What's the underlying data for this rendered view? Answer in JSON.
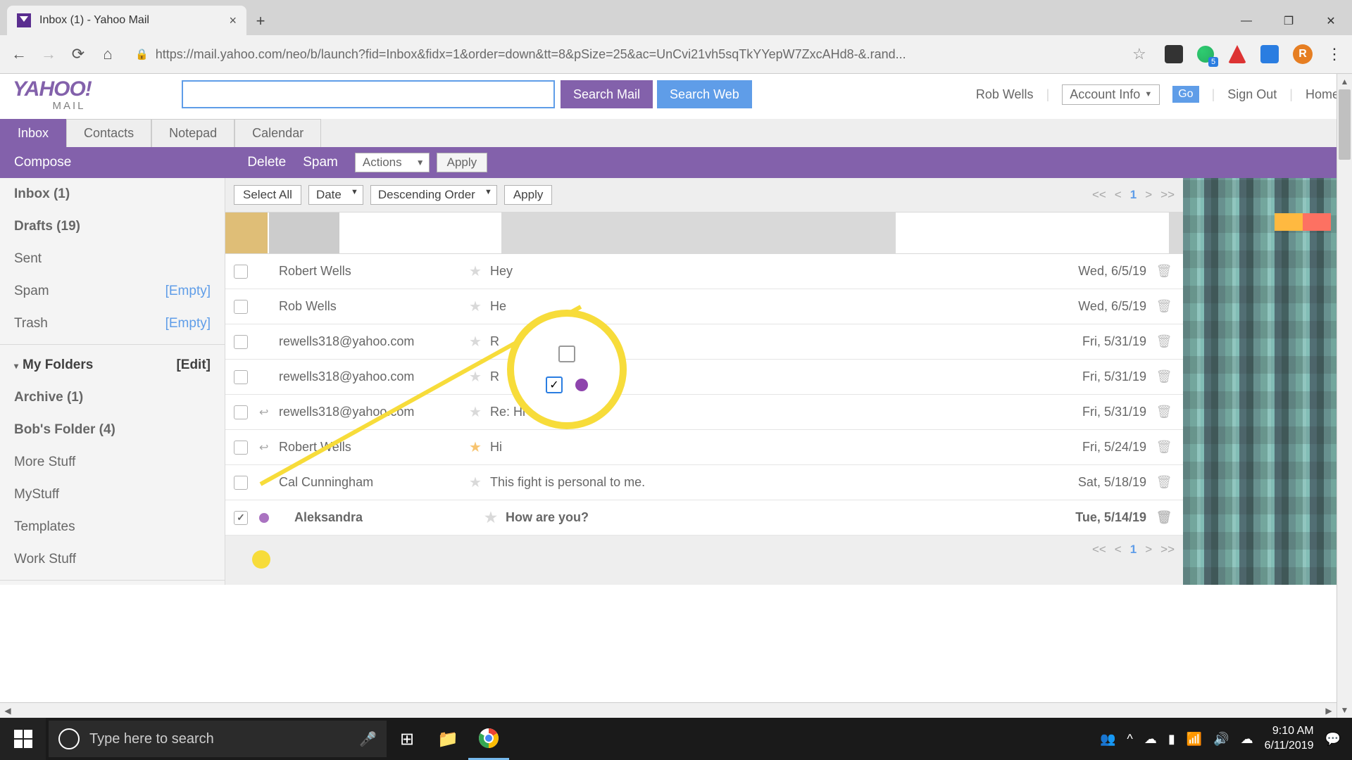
{
  "browser": {
    "tab_title": "Inbox (1) - Yahoo Mail",
    "url": "https://mail.yahoo.com/neo/b/launch?fid=Inbox&fidx=1&order=down&tt=8&pSize=25&ac=UnCvi21vh5sqTkYYepW7ZxcAHd8-&.rand...",
    "profile_letter": "R"
  },
  "header": {
    "logo_main": "YAHOO!",
    "logo_sub": "MAIL",
    "search_mail": "Search Mail",
    "search_web": "Search Web",
    "user": "Rob Wells",
    "account_info": "Account Info",
    "go": "Go",
    "sign_out": "Sign Out",
    "home": "Home"
  },
  "tabs": {
    "inbox": "Inbox",
    "contacts": "Contacts",
    "notepad": "Notepad",
    "calendar": "Calendar"
  },
  "actionbar": {
    "compose": "Compose",
    "delete": "Delete",
    "spam": "Spam",
    "actions": "Actions",
    "apply": "Apply"
  },
  "toolbar": {
    "select_all": "Select All",
    "sort_field": "Date",
    "sort_order": "Descending Order",
    "apply": "Apply",
    "page": "1"
  },
  "sidebar": {
    "inbox": "Inbox (1)",
    "drafts": "Drafts (19)",
    "sent": "Sent",
    "spam": "Spam",
    "trash": "Trash",
    "empty": "[Empty]",
    "my_folders": "My Folders",
    "edit": "[Edit]",
    "folders": {
      "archive": "Archive (1)",
      "bobs": "Bob's Folder (4)",
      "more": "More Stuff",
      "mystuff": "MyStuff",
      "templates": "Templates",
      "work": "Work Stuff"
    }
  },
  "emails": [
    {
      "checked": false,
      "replied": false,
      "sender": "Robert Wells",
      "starred": false,
      "subject": "Hey",
      "date": "Wed, 6/5/19",
      "unread": false
    },
    {
      "checked": false,
      "replied": false,
      "sender": "Rob Wells",
      "starred": false,
      "subject": "He",
      "date": "Wed, 6/5/19",
      "unread": false
    },
    {
      "checked": false,
      "replied": false,
      "sender": "rewells318@yahoo.com",
      "starred": false,
      "subject": "R",
      "date": "Fri, 5/31/19",
      "unread": false
    },
    {
      "checked": false,
      "replied": false,
      "sender": "rewells318@yahoo.com",
      "starred": false,
      "subject": "R",
      "date": "Fri, 5/31/19",
      "unread": false
    },
    {
      "checked": false,
      "replied": true,
      "sender": "rewells318@yahoo.com",
      "starred": false,
      "subject": "Re: Hi",
      "date": "Fri, 5/31/19",
      "unread": false
    },
    {
      "checked": false,
      "replied": true,
      "sender": "Robert Wells",
      "starred": true,
      "subject": "Hi",
      "date": "Fri, 5/24/19",
      "unread": false
    },
    {
      "checked": false,
      "replied": false,
      "sender": "Cal Cunningham",
      "starred": false,
      "subject": "This fight is personal to me.",
      "date": "Sat, 5/18/19",
      "unread": false
    },
    {
      "checked": true,
      "replied": false,
      "sender": "Aleksandra",
      "starred": false,
      "subject": "How are you?",
      "date": "Tue, 5/14/19",
      "unread": true
    }
  ],
  "taskbar": {
    "search_placeholder": "Type here to search",
    "time": "9:10 AM",
    "date": "6/11/2019"
  }
}
